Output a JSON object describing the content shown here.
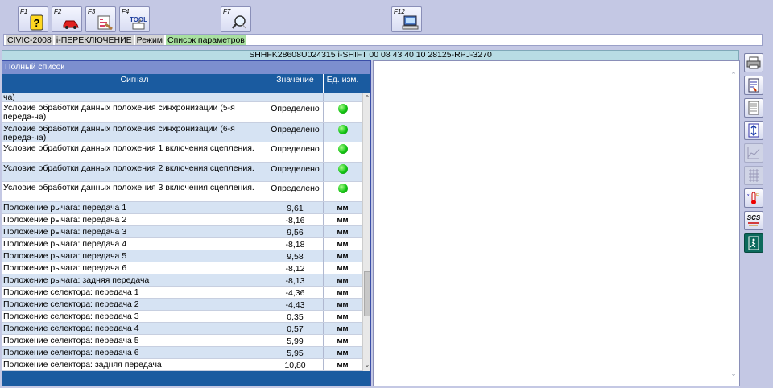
{
  "toolbar": {
    "buttons": [
      {
        "key": "F1",
        "icon": "help-icon"
      },
      {
        "key": "F2",
        "icon": "car-icon"
      },
      {
        "key": "F3",
        "icon": "hand-checklist-icon"
      },
      {
        "key": "F4",
        "icon": "tool-icon",
        "text": "TOOL"
      },
      {
        "key": "F7",
        "icon": "magnifier-icon"
      },
      {
        "key": "F12",
        "icon": "computer-icon"
      }
    ]
  },
  "breadcrumb": [
    "CIVIC-2008",
    "i-ПЕРЕКЛЮЧЕНИЕ",
    "Режим",
    "Список параметров"
  ],
  "vehicle_id": "SHHFK28608U024315  i-SHIFT  00 08 43 40 10  28125-RPJ-3270",
  "left_panel": {
    "title": "Полный список",
    "columns": [
      "Сигнал",
      "Значение",
      "Ед. изм."
    ],
    "rows": [
      {
        "signal": "ча)",
        "value": "",
        "unit": "dot",
        "cut": true
      },
      {
        "signal": "Условие обработки данных положения синхронизации (5-я переда-ча)",
        "value": "Определено",
        "unit": "dot"
      },
      {
        "signal": "Условие обработки данных положения синхронизации (6-я переда-ча)",
        "value": "Определено",
        "unit": "dot"
      },
      {
        "signal": "Условие обработки данных положения 1 включения сцепления.",
        "value": "Определено",
        "unit": "dot"
      },
      {
        "signal": "Условие обработки данных положения 2 включения сцепления.",
        "value": "Определено",
        "unit": "dot"
      },
      {
        "signal": "Условие обработки данных положения 3 включения сцепления.",
        "value": "Определено",
        "unit": "dot"
      },
      {
        "signal": "Положение рычага: передача 1",
        "value": "9,61",
        "unit": "мм"
      },
      {
        "signal": "Положение рычага: передача 2",
        "value": "-8,16",
        "unit": "мм"
      },
      {
        "signal": "Положение рычага: передача 3",
        "value": "9,56",
        "unit": "мм"
      },
      {
        "signal": "Положение рычага: передача 4",
        "value": "-8,18",
        "unit": "мм"
      },
      {
        "signal": "Положение рычага: передача 5",
        "value": "9,58",
        "unit": "мм"
      },
      {
        "signal": "Положение рычага: передача 6",
        "value": "-8,12",
        "unit": "мм"
      },
      {
        "signal": "Положение рычага: задняя передача",
        "value": "-8,13",
        "unit": "мм"
      },
      {
        "signal": "Положение селектора: передача 1",
        "value": "-4,36",
        "unit": "мм"
      },
      {
        "signal": "Положение селектора: передача 2",
        "value": "-4,43",
        "unit": "мм"
      },
      {
        "signal": "Положение селектора: передача 3",
        "value": "0,35",
        "unit": "мм"
      },
      {
        "signal": "Положение селектора: передача 4",
        "value": "0,57",
        "unit": "мм"
      },
      {
        "signal": "Положение селектора: передача 5",
        "value": "5,99",
        "unit": "мм"
      },
      {
        "signal": "Положение селектора: передача 6",
        "value": "5,95",
        "unit": "мм"
      },
      {
        "signal": "Положение селектора: задняя передача",
        "value": "10,80",
        "unit": "мм"
      }
    ]
  },
  "side_buttons": [
    {
      "icon": "printer-icon"
    },
    {
      "icon": "snapshot-icon"
    },
    {
      "icon": "list-icon"
    },
    {
      "icon": "sort-icon"
    },
    {
      "icon": "graph-icon",
      "disabled": true
    },
    {
      "icon": "grid-icon",
      "disabled": true
    },
    {
      "icon": "thermometer-icon"
    },
    {
      "icon": "scs-icon",
      "text": "SCS"
    },
    {
      "icon": "exit-icon"
    }
  ],
  "colors": {
    "background": "#c4c8e4",
    "header_blue": "#1a5ba0",
    "row_alt": "#d6e3f3",
    "status_ok": "#14c414",
    "crumb_active": "#a8e0a0"
  }
}
